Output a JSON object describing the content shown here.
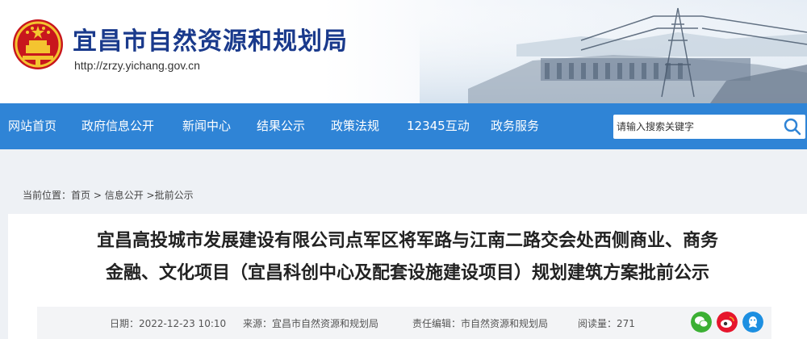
{
  "header": {
    "site_title": "宜昌市自然资源和规划局",
    "site_url": "http://zrzy.yichang.gov.cn"
  },
  "nav": {
    "items": [
      {
        "label": "网站首页"
      },
      {
        "label": "政府信息公开"
      },
      {
        "label": "新闻中心"
      },
      {
        "label": "结果公示"
      },
      {
        "label": "政策法规"
      },
      {
        "label": "12345互动"
      },
      {
        "label": "政务服务"
      }
    ],
    "search_placeholder": "请输入搜索关键字"
  },
  "breadcrumb": {
    "prefix": "当前位置：",
    "items": [
      "首页",
      "信息公开",
      "批前公示"
    ],
    "sep1": " > ",
    "sep2": " >"
  },
  "article": {
    "title_line1": "宜昌高投城市发展建设有限公司点军区将军路与江南二路交会处西侧商业、商务",
    "title_line2": "金融、文化项目（宜昌科创中心及配套设施建设项目）规划建筑方案批前公示"
  },
  "meta": {
    "date": "日期：2022-12-23 10:10",
    "source": "来源：宜昌市自然资源和规划局",
    "editor": "责任编辑：市自然资源和规划局",
    "views": "阅读量：271"
  },
  "colors": {
    "nav_bg": "#2f84d6",
    "title_blue": "#1a3a8c",
    "wechat_green": "#3cb034",
    "weibo_red": "#e6162d",
    "qq_blue": "#1d8fe1"
  },
  "share_icons": [
    "wechat-icon",
    "weibo-icon",
    "qq-icon"
  ]
}
